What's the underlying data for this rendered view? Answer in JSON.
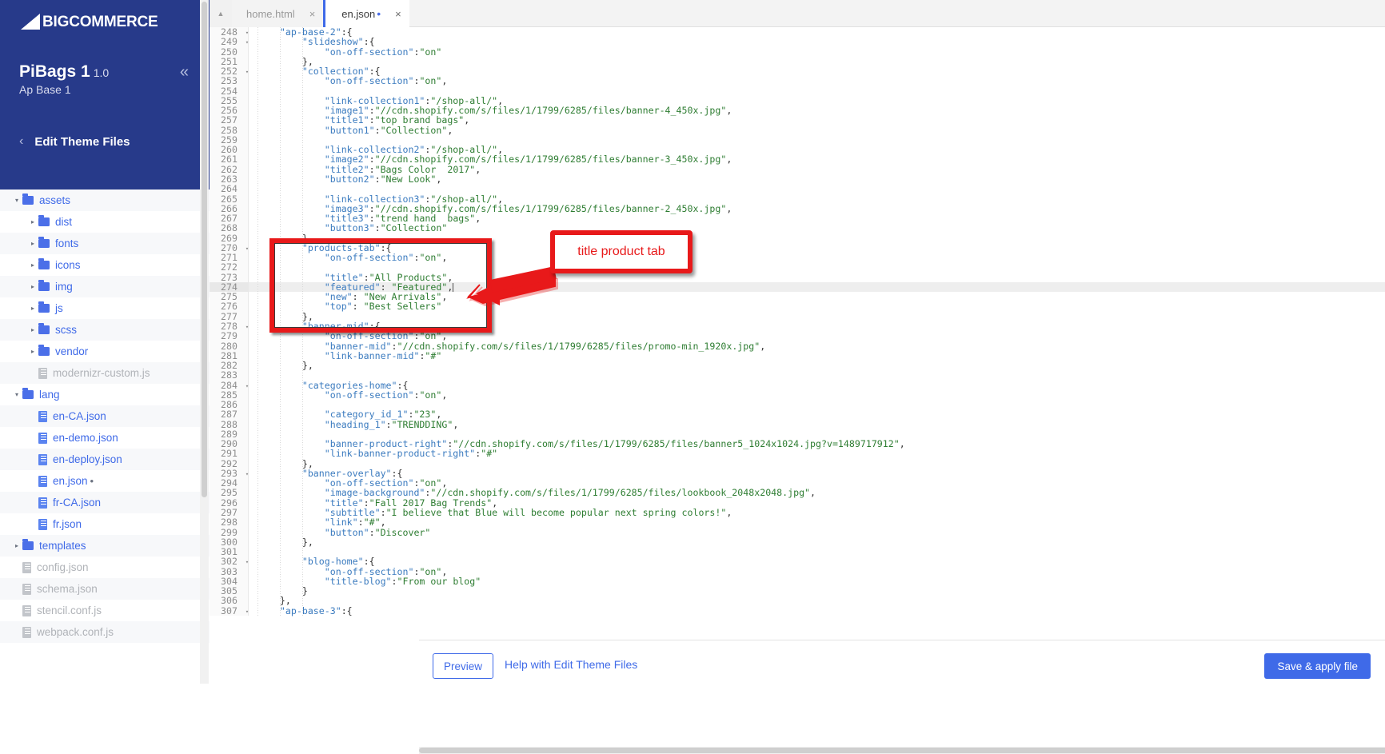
{
  "brand": {
    "logo_text": "COMMERCE",
    "logo_prefix": "BIG"
  },
  "sidebar": {
    "theme_name": "PiBags 1",
    "theme_version": "1.0",
    "theme_variation": "Ap Base 1",
    "collapse_icon": "«",
    "back_icon": "‹",
    "section_label": "Edit Theme Files",
    "tree": [
      {
        "label": "assets",
        "type": "folder",
        "depth": 0,
        "state": "open",
        "muted": false
      },
      {
        "label": "dist",
        "type": "folder",
        "depth": 1,
        "state": "closed",
        "muted": false
      },
      {
        "label": "fonts",
        "type": "folder",
        "depth": 1,
        "state": "closed",
        "muted": false
      },
      {
        "label": "icons",
        "type": "folder",
        "depth": 1,
        "state": "closed",
        "muted": false
      },
      {
        "label": "img",
        "type": "folder",
        "depth": 1,
        "state": "closed",
        "muted": false
      },
      {
        "label": "js",
        "type": "folder",
        "depth": 1,
        "state": "closed",
        "muted": false
      },
      {
        "label": "scss",
        "type": "folder",
        "depth": 1,
        "state": "closed",
        "muted": false
      },
      {
        "label": "vendor",
        "type": "folder",
        "depth": 1,
        "state": "closed",
        "muted": false
      },
      {
        "label": "modernizr-custom.js",
        "type": "file",
        "depth": 1,
        "state": "none",
        "muted": true
      },
      {
        "label": "lang",
        "type": "folder",
        "depth": 0,
        "state": "open",
        "muted": false
      },
      {
        "label": "en-CA.json",
        "type": "file",
        "depth": 1,
        "state": "none",
        "muted": false
      },
      {
        "label": "en-demo.json",
        "type": "file",
        "depth": 1,
        "state": "none",
        "muted": false
      },
      {
        "label": "en-deploy.json",
        "type": "file",
        "depth": 1,
        "state": "none",
        "muted": false
      },
      {
        "label": "en.json",
        "type": "file",
        "depth": 1,
        "state": "none",
        "muted": false,
        "dirty": true
      },
      {
        "label": "fr-CA.json",
        "type": "file",
        "depth": 1,
        "state": "none",
        "muted": false
      },
      {
        "label": "fr.json",
        "type": "file",
        "depth": 1,
        "state": "none",
        "muted": false
      },
      {
        "label": "templates",
        "type": "folder",
        "depth": 0,
        "state": "closed",
        "muted": false
      },
      {
        "label": "config.json",
        "type": "file",
        "depth": 0,
        "state": "none",
        "muted": true
      },
      {
        "label": "schema.json",
        "type": "file",
        "depth": 0,
        "state": "none",
        "muted": true
      },
      {
        "label": "stencil.conf.js",
        "type": "file",
        "depth": 0,
        "state": "none",
        "muted": true
      },
      {
        "label": "webpack.conf.js",
        "type": "file",
        "depth": 0,
        "state": "none",
        "muted": true
      }
    ]
  },
  "tabs": [
    {
      "label": "home.html",
      "active": false,
      "dirty": false,
      "close_icon": "×"
    },
    {
      "label": "en.json",
      "active": true,
      "dirty": true,
      "dirty_marker": "•",
      "close_icon": "×"
    }
  ],
  "editor": {
    "first_line": 248,
    "active_line": 274,
    "folded_lines": [
      248,
      249,
      252,
      270,
      278,
      284,
      293,
      302,
      307
    ],
    "lines": [
      {
        "n": 248,
        "indent": 1,
        "text": "\"ap-base-2\":{"
      },
      {
        "n": 249,
        "indent": 2,
        "text": "\"slideshow\":{"
      },
      {
        "n": 250,
        "indent": 3,
        "text": "\"on-off-section\":\"on\""
      },
      {
        "n": 251,
        "indent": 2,
        "text": "},"
      },
      {
        "n": 252,
        "indent": 2,
        "text": "\"collection\":{"
      },
      {
        "n": 253,
        "indent": 3,
        "text": "\"on-off-section\":\"on\","
      },
      {
        "n": 254,
        "indent": 0,
        "text": ""
      },
      {
        "n": 255,
        "indent": 3,
        "text": "\"link-collection1\":\"/shop-all/\","
      },
      {
        "n": 256,
        "indent": 3,
        "text": "\"image1\":\"//cdn.shopify.com/s/files/1/1799/6285/files/banner-4_450x.jpg\","
      },
      {
        "n": 257,
        "indent": 3,
        "text": "\"title1\":\"top brand bags\","
      },
      {
        "n": 258,
        "indent": 3,
        "text": "\"button1\":\"Collection\","
      },
      {
        "n": 259,
        "indent": 0,
        "text": ""
      },
      {
        "n": 260,
        "indent": 3,
        "text": "\"link-collection2\":\"/shop-all/\","
      },
      {
        "n": 261,
        "indent": 3,
        "text": "\"image2\":\"//cdn.shopify.com/s/files/1/1799/6285/files/banner-3_450x.jpg\","
      },
      {
        "n": 262,
        "indent": 3,
        "text": "\"title2\":\"Bags Color  2017\","
      },
      {
        "n": 263,
        "indent": 3,
        "text": "\"button2\":\"New Look\","
      },
      {
        "n": 264,
        "indent": 0,
        "text": ""
      },
      {
        "n": 265,
        "indent": 3,
        "text": "\"link-collection3\":\"/shop-all/\","
      },
      {
        "n": 266,
        "indent": 3,
        "text": "\"image3\":\"//cdn.shopify.com/s/files/1/1799/6285/files/banner-2_450x.jpg\","
      },
      {
        "n": 267,
        "indent": 3,
        "text": "\"title3\":\"trend hand  bags\","
      },
      {
        "n": 268,
        "indent": 3,
        "text": "\"button3\":\"Collection\""
      },
      {
        "n": 269,
        "indent": 2,
        "text": "},"
      },
      {
        "n": 270,
        "indent": 2,
        "text": "\"products-tab\":{"
      },
      {
        "n": 271,
        "indent": 3,
        "text": "\"on-off-section\":\"on\","
      },
      {
        "n": 272,
        "indent": 0,
        "text": ""
      },
      {
        "n": 273,
        "indent": 3,
        "text": "\"title\":\"All Products\","
      },
      {
        "n": 274,
        "indent": 3,
        "text": "\"featured\": \"Featured\","
      },
      {
        "n": 275,
        "indent": 3,
        "text": "\"new\": \"New Arrivals\","
      },
      {
        "n": 276,
        "indent": 3,
        "text": "\"top\": \"Best Sellers\""
      },
      {
        "n": 277,
        "indent": 2,
        "text": "},"
      },
      {
        "n": 278,
        "indent": 2,
        "text": "\"banner-mid\":{"
      },
      {
        "n": 279,
        "indent": 3,
        "text": "\"on-off-section\":\"on\","
      },
      {
        "n": 280,
        "indent": 3,
        "text": "\"banner-mid\":\"//cdn.shopify.com/s/files/1/1799/6285/files/promo-min_1920x.jpg\","
      },
      {
        "n": 281,
        "indent": 3,
        "text": "\"link-banner-mid\":\"#\""
      },
      {
        "n": 282,
        "indent": 2,
        "text": "},"
      },
      {
        "n": 283,
        "indent": 0,
        "text": ""
      },
      {
        "n": 284,
        "indent": 2,
        "text": "\"categories-home\":{"
      },
      {
        "n": 285,
        "indent": 3,
        "text": "\"on-off-section\":\"on\","
      },
      {
        "n": 286,
        "indent": 0,
        "text": ""
      },
      {
        "n": 287,
        "indent": 3,
        "text": "\"category_id_1\":\"23\","
      },
      {
        "n": 288,
        "indent": 3,
        "text": "\"heading_1\":\"TRENDDING\","
      },
      {
        "n": 289,
        "indent": 0,
        "text": ""
      },
      {
        "n": 290,
        "indent": 3,
        "text": "\"banner-product-right\":\"//cdn.shopify.com/s/files/1/1799/6285/files/banner5_1024x1024.jpg?v=1489717912\","
      },
      {
        "n": 291,
        "indent": 3,
        "text": "\"link-banner-product-right\":\"#\""
      },
      {
        "n": 292,
        "indent": 2,
        "text": "},"
      },
      {
        "n": 293,
        "indent": 2,
        "text": "\"banner-overlay\":{"
      },
      {
        "n": 294,
        "indent": 3,
        "text": "\"on-off-section\":\"on\","
      },
      {
        "n": 295,
        "indent": 3,
        "text": "\"image-background\":\"//cdn.shopify.com/s/files/1/1799/6285/files/lookbook_2048x2048.jpg\","
      },
      {
        "n": 296,
        "indent": 3,
        "text": "\"title\":\"Fall 2017 Bag Trends\","
      },
      {
        "n": 297,
        "indent": 3,
        "text": "\"subtitle\":\"I believe that Blue will become popular next spring colors!\","
      },
      {
        "n": 298,
        "indent": 3,
        "text": "\"link\":\"#\","
      },
      {
        "n": 299,
        "indent": 3,
        "text": "\"button\":\"Discover\""
      },
      {
        "n": 300,
        "indent": 2,
        "text": "},"
      },
      {
        "n": 301,
        "indent": 0,
        "text": ""
      },
      {
        "n": 302,
        "indent": 2,
        "text": "\"blog-home\":{"
      },
      {
        "n": 303,
        "indent": 3,
        "text": "\"on-off-section\":\"on\","
      },
      {
        "n": 304,
        "indent": 3,
        "text": "\"title-blog\":\"From our blog\""
      },
      {
        "n": 305,
        "indent": 2,
        "text": "}"
      },
      {
        "n": 306,
        "indent": 1,
        "text": "},"
      },
      {
        "n": 307,
        "indent": 1,
        "text": "\"ap-base-3\":{"
      }
    ]
  },
  "annotation": {
    "callout_text": "title product tab",
    "accent_color": "#e8191a"
  },
  "footer": {
    "preview_label": "Preview",
    "help_label": "Help with Edit Theme Files",
    "save_label": "Save & apply file"
  }
}
